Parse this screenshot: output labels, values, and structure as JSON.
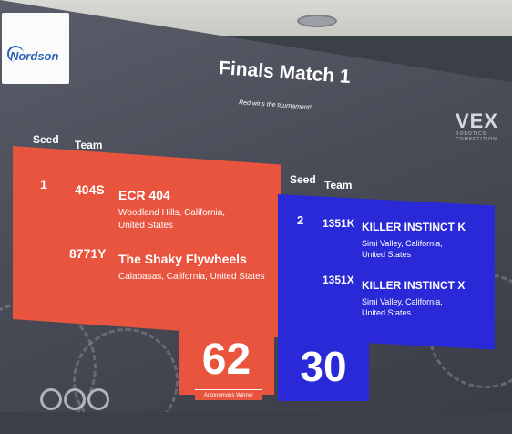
{
  "header": {
    "logo": "Nordson",
    "title": "Finals Match 1",
    "subtitle": "Red wins the tournament!",
    "brand": "VEX",
    "brand_sub": "ROBOTICS COMPETITION"
  },
  "columns": {
    "seed": "Seed",
    "team": "Team"
  },
  "red": {
    "seed": "1",
    "teams": [
      {
        "number": "404S",
        "name": "ECR 404",
        "location_line1": "Woodland Hills, California,",
        "location_line2": "United States"
      },
      {
        "number": "8771Y",
        "name": "The Shaky Flywheels",
        "location_line1": "Calabasas, California, United States",
        "location_line2": ""
      }
    ],
    "score": "62",
    "badge": "Autonomous Winner"
  },
  "blue": {
    "seed": "2",
    "teams": [
      {
        "number": "1351K",
        "name": "KILLER INSTINCT K",
        "location_line1": "Simi Valley, California,",
        "location_line2": "United States"
      },
      {
        "number": "1351X",
        "name": "KILLER INSTINCT X",
        "location_line1": "Simi Valley, California,",
        "location_line2": "United States"
      }
    ],
    "score": "30"
  },
  "colors": {
    "red": "#e8543e",
    "blue": "#2929d8",
    "background": "#4a4d58"
  }
}
